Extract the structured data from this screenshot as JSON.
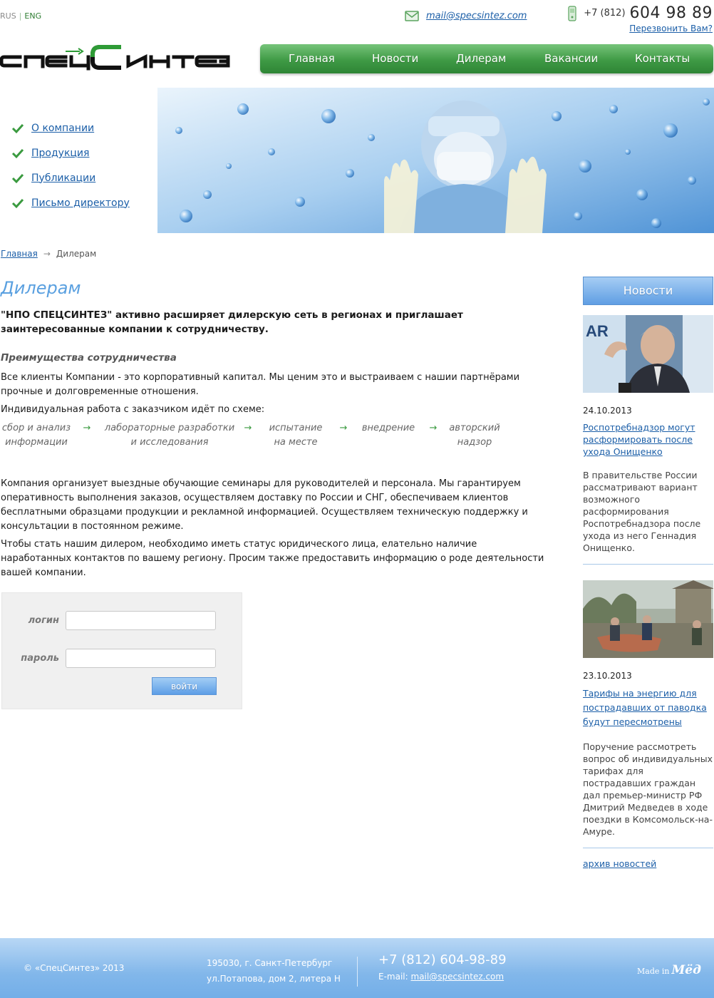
{
  "header": {
    "lang_rus": "RUS",
    "lang_sep": "|",
    "lang_eng": "ENG",
    "email": "mail@specsintez.com",
    "phone_code": "+7 (812)",
    "phone_number": "604 98 89",
    "callback": "Перезвонить Вам?",
    "logo_text": "СПЕЦСИНТЕЗ"
  },
  "nav": [
    "Главная",
    "Новости",
    "Дилерам",
    "Вакансии",
    "Контакты"
  ],
  "sidebar": {
    "items": [
      "О компании",
      "Продукция",
      "Публикации",
      "Письмо директору"
    ]
  },
  "breadcrumb": {
    "home": "Главная",
    "arrow": "→",
    "current": "Дилерам"
  },
  "main": {
    "title": "Дилерам",
    "lead": "\"НПО СПЕЦСИНТЕЗ\" активно расширяет дилерскую сеть в регионах и приглашает заинтересованные компании к сотрудничеству.",
    "subhead": "Преимущества сотрудничества",
    "p1": "Все клиенты Компании - это корпоративный капитал. Мы ценим это и выстраиваем с нашии партнёрами прочные и долговременные отношения.",
    "p2": "Индивидуальная работа с заказчиком идёт по схеме:",
    "flow": [
      {
        "line1": "сбор и анализ",
        "line2": "информации"
      },
      {
        "line1": "лабораторные разработки",
        "line2": "и исследования"
      },
      {
        "line1": "испытание",
        "line2": "на месте"
      },
      {
        "line1": "внедрение",
        "line2": ""
      },
      {
        "line1": "авторский",
        "line2": "надзор"
      }
    ],
    "flow_arrow": "→",
    "p3": "Компания организует выездные обучающие семинары для руководителей и персонала. Мы гарантируем оперативность выполнения заказов, осуществляем доставку по России и СНГ, обеспечиваем клиентов бесплатными образцами продукции и рекламной информацией. Осуществляем техническую поддержку и консультации в постоянном режиме.",
    "p4": "Чтобы стать нашим дилером, необходимо иметь статус юридического лица, елательно наличие наработанных контактов по вашему региону. Просим также предоставить информацию о роде деятельности вашей компании."
  },
  "login": {
    "login_label": "логин",
    "password_label": "пароль",
    "login_value": "",
    "password_value": "",
    "button": "войти"
  },
  "news": {
    "heading": "Новости",
    "items": [
      {
        "date": "24.10.2013",
        "title": "Роспотребнадзор могут расформировать после ухода Онищенко",
        "text": "В правительстве России рассматривают вариант возможного расформирования Роспотребнадзора после ухода из него Геннадия Онищенко."
      },
      {
        "date": "23.10.2013",
        "title": "Тарифы на энергию для пострадавших от паводка будут пересмотрены",
        "text": "Поручение рассмотреть вопрос об индивидуальных тарифах для пострадавших граждан дал премьер-министр РФ Дмитрий Медведев в ходе поездки в Комсомольск-на-Амуре."
      }
    ],
    "archive": "архив новостей"
  },
  "footer": {
    "copyright": "© «СпецСинтез» 2013",
    "address1": "195030, г. Санкт-Петербург",
    "address2": "ул.Потапова, дом 2, литера Н",
    "phone": "+7 (812) 604-98-89",
    "email_label": "E-mail:",
    "email": "mail@specsintez.com",
    "made_in": "Made in",
    "made_in_brand": "Мёд"
  },
  "colors": {
    "nav_green": "#3f9a45",
    "link_blue": "#1c5fa8",
    "title_blue": "#5aa0e0",
    "footer_blue": "#82b7ea"
  }
}
